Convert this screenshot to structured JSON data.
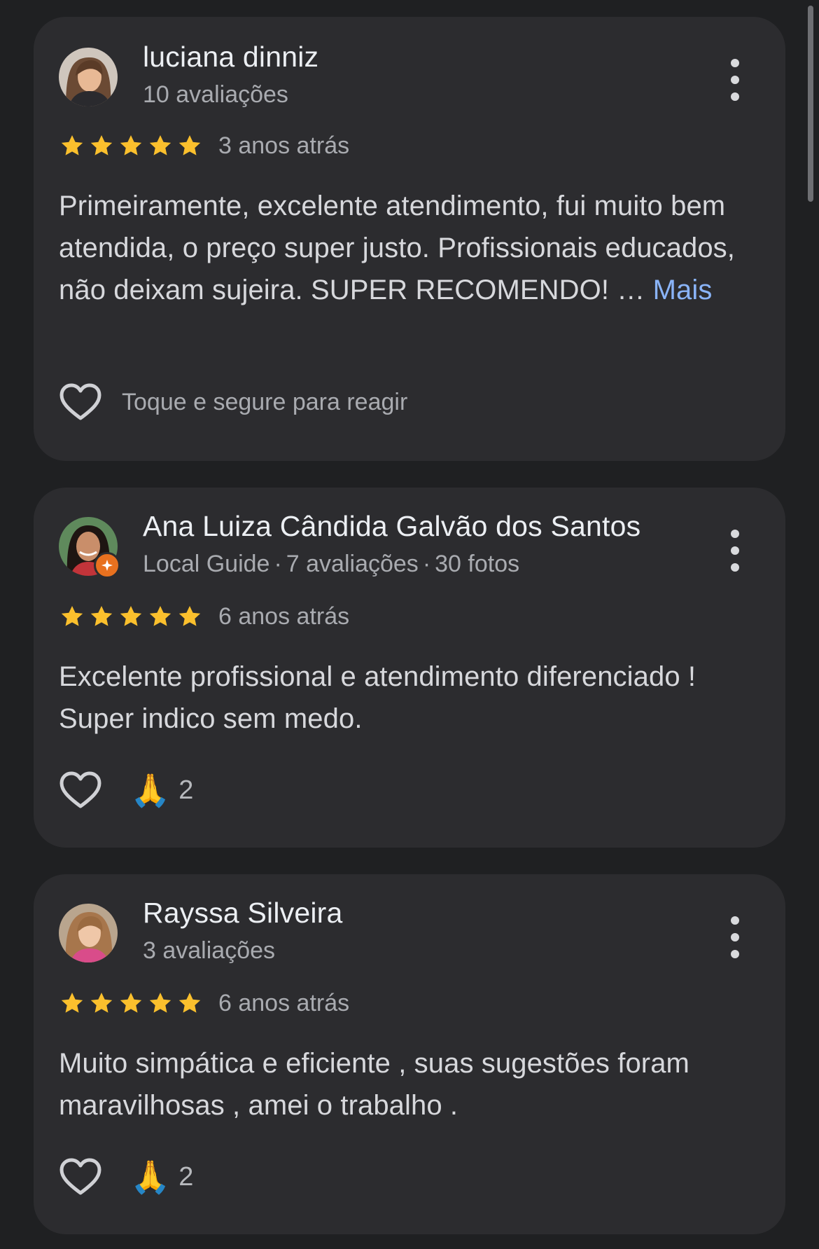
{
  "colors": {
    "background": "#1f2022",
    "card": "#2c2c2f",
    "star": "#fbc02d",
    "link": "#8ab4f8",
    "local_guide_badge": "#e8711f"
  },
  "reviews": [
    {
      "name": "luciana dinniz",
      "meta": "10 avaliações",
      "rating": 5,
      "time": "3 anos atrás",
      "text": "Primeiramente, excelente atendimento, fui muito bem atendida, o preço super justo. Profissionais educados, não deixam sujeira. SUPER RECOMENDO! … ",
      "more_label": "Mais",
      "react_hint": "Toque e segure para reagir",
      "menu_icon": "more-vert-icon"
    },
    {
      "name": "Ana Luiza Cândida Galvão dos Santos",
      "meta_badge": "Local Guide",
      "meta_reviews": "7 avaliações",
      "meta_photos": "30 fotos",
      "meta_separator": "·",
      "rating": 5,
      "time": "6 anos atrás",
      "text": "Excelente profissional e atendimento diferenciado ! Super indico sem medo.",
      "reaction_emoji": "🙏",
      "reaction_count": "2",
      "menu_icon": "more-vert-icon"
    },
    {
      "name": "Rayssa Silveira",
      "meta": "3 avaliações",
      "rating": 5,
      "time": "6 anos atrás",
      "text": "Muito simpática e eficiente , suas sugestões foram maravilhosas , amei o trabalho .",
      "reaction_emoji": "🙏",
      "reaction_count": "2",
      "menu_icon": "more-vert-icon"
    }
  ]
}
